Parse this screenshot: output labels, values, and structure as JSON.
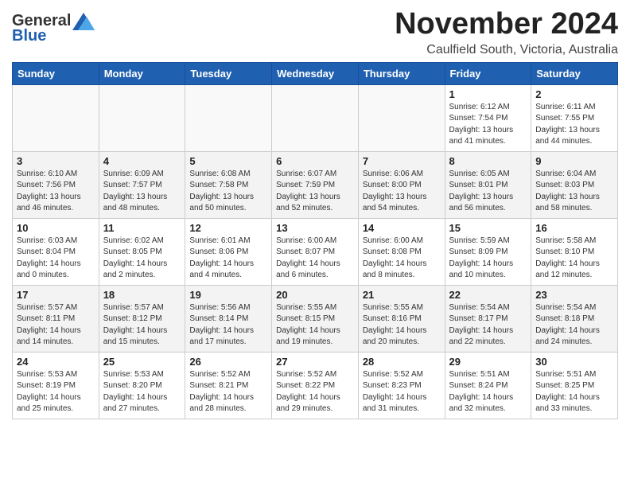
{
  "header": {
    "logo_general": "General",
    "logo_blue": "Blue",
    "month": "November 2024",
    "location": "Caulfield South, Victoria, Australia"
  },
  "weekdays": [
    "Sunday",
    "Monday",
    "Tuesday",
    "Wednesday",
    "Thursday",
    "Friday",
    "Saturday"
  ],
  "weeks": [
    [
      {
        "day": "",
        "info": ""
      },
      {
        "day": "",
        "info": ""
      },
      {
        "day": "",
        "info": ""
      },
      {
        "day": "",
        "info": ""
      },
      {
        "day": "",
        "info": ""
      },
      {
        "day": "1",
        "info": "Sunrise: 6:12 AM\nSunset: 7:54 PM\nDaylight: 13 hours\nand 41 minutes."
      },
      {
        "day": "2",
        "info": "Sunrise: 6:11 AM\nSunset: 7:55 PM\nDaylight: 13 hours\nand 44 minutes."
      }
    ],
    [
      {
        "day": "3",
        "info": "Sunrise: 6:10 AM\nSunset: 7:56 PM\nDaylight: 13 hours\nand 46 minutes."
      },
      {
        "day": "4",
        "info": "Sunrise: 6:09 AM\nSunset: 7:57 PM\nDaylight: 13 hours\nand 48 minutes."
      },
      {
        "day": "5",
        "info": "Sunrise: 6:08 AM\nSunset: 7:58 PM\nDaylight: 13 hours\nand 50 minutes."
      },
      {
        "day": "6",
        "info": "Sunrise: 6:07 AM\nSunset: 7:59 PM\nDaylight: 13 hours\nand 52 minutes."
      },
      {
        "day": "7",
        "info": "Sunrise: 6:06 AM\nSunset: 8:00 PM\nDaylight: 13 hours\nand 54 minutes."
      },
      {
        "day": "8",
        "info": "Sunrise: 6:05 AM\nSunset: 8:01 PM\nDaylight: 13 hours\nand 56 minutes."
      },
      {
        "day": "9",
        "info": "Sunrise: 6:04 AM\nSunset: 8:03 PM\nDaylight: 13 hours\nand 58 minutes."
      }
    ],
    [
      {
        "day": "10",
        "info": "Sunrise: 6:03 AM\nSunset: 8:04 PM\nDaylight: 14 hours\nand 0 minutes."
      },
      {
        "day": "11",
        "info": "Sunrise: 6:02 AM\nSunset: 8:05 PM\nDaylight: 14 hours\nand 2 minutes."
      },
      {
        "day": "12",
        "info": "Sunrise: 6:01 AM\nSunset: 8:06 PM\nDaylight: 14 hours\nand 4 minutes."
      },
      {
        "day": "13",
        "info": "Sunrise: 6:00 AM\nSunset: 8:07 PM\nDaylight: 14 hours\nand 6 minutes."
      },
      {
        "day": "14",
        "info": "Sunrise: 6:00 AM\nSunset: 8:08 PM\nDaylight: 14 hours\nand 8 minutes."
      },
      {
        "day": "15",
        "info": "Sunrise: 5:59 AM\nSunset: 8:09 PM\nDaylight: 14 hours\nand 10 minutes."
      },
      {
        "day": "16",
        "info": "Sunrise: 5:58 AM\nSunset: 8:10 PM\nDaylight: 14 hours\nand 12 minutes."
      }
    ],
    [
      {
        "day": "17",
        "info": "Sunrise: 5:57 AM\nSunset: 8:11 PM\nDaylight: 14 hours\nand 14 minutes."
      },
      {
        "day": "18",
        "info": "Sunrise: 5:57 AM\nSunset: 8:12 PM\nDaylight: 14 hours\nand 15 minutes."
      },
      {
        "day": "19",
        "info": "Sunrise: 5:56 AM\nSunset: 8:14 PM\nDaylight: 14 hours\nand 17 minutes."
      },
      {
        "day": "20",
        "info": "Sunrise: 5:55 AM\nSunset: 8:15 PM\nDaylight: 14 hours\nand 19 minutes."
      },
      {
        "day": "21",
        "info": "Sunrise: 5:55 AM\nSunset: 8:16 PM\nDaylight: 14 hours\nand 20 minutes."
      },
      {
        "day": "22",
        "info": "Sunrise: 5:54 AM\nSunset: 8:17 PM\nDaylight: 14 hours\nand 22 minutes."
      },
      {
        "day": "23",
        "info": "Sunrise: 5:54 AM\nSunset: 8:18 PM\nDaylight: 14 hours\nand 24 minutes."
      }
    ],
    [
      {
        "day": "24",
        "info": "Sunrise: 5:53 AM\nSunset: 8:19 PM\nDaylight: 14 hours\nand 25 minutes."
      },
      {
        "day": "25",
        "info": "Sunrise: 5:53 AM\nSunset: 8:20 PM\nDaylight: 14 hours\nand 27 minutes."
      },
      {
        "day": "26",
        "info": "Sunrise: 5:52 AM\nSunset: 8:21 PM\nDaylight: 14 hours\nand 28 minutes."
      },
      {
        "day": "27",
        "info": "Sunrise: 5:52 AM\nSunset: 8:22 PM\nDaylight: 14 hours\nand 29 minutes."
      },
      {
        "day": "28",
        "info": "Sunrise: 5:52 AM\nSunset: 8:23 PM\nDaylight: 14 hours\nand 31 minutes."
      },
      {
        "day": "29",
        "info": "Sunrise: 5:51 AM\nSunset: 8:24 PM\nDaylight: 14 hours\nand 32 minutes."
      },
      {
        "day": "30",
        "info": "Sunrise: 5:51 AM\nSunset: 8:25 PM\nDaylight: 14 hours\nand 33 minutes."
      }
    ]
  ]
}
